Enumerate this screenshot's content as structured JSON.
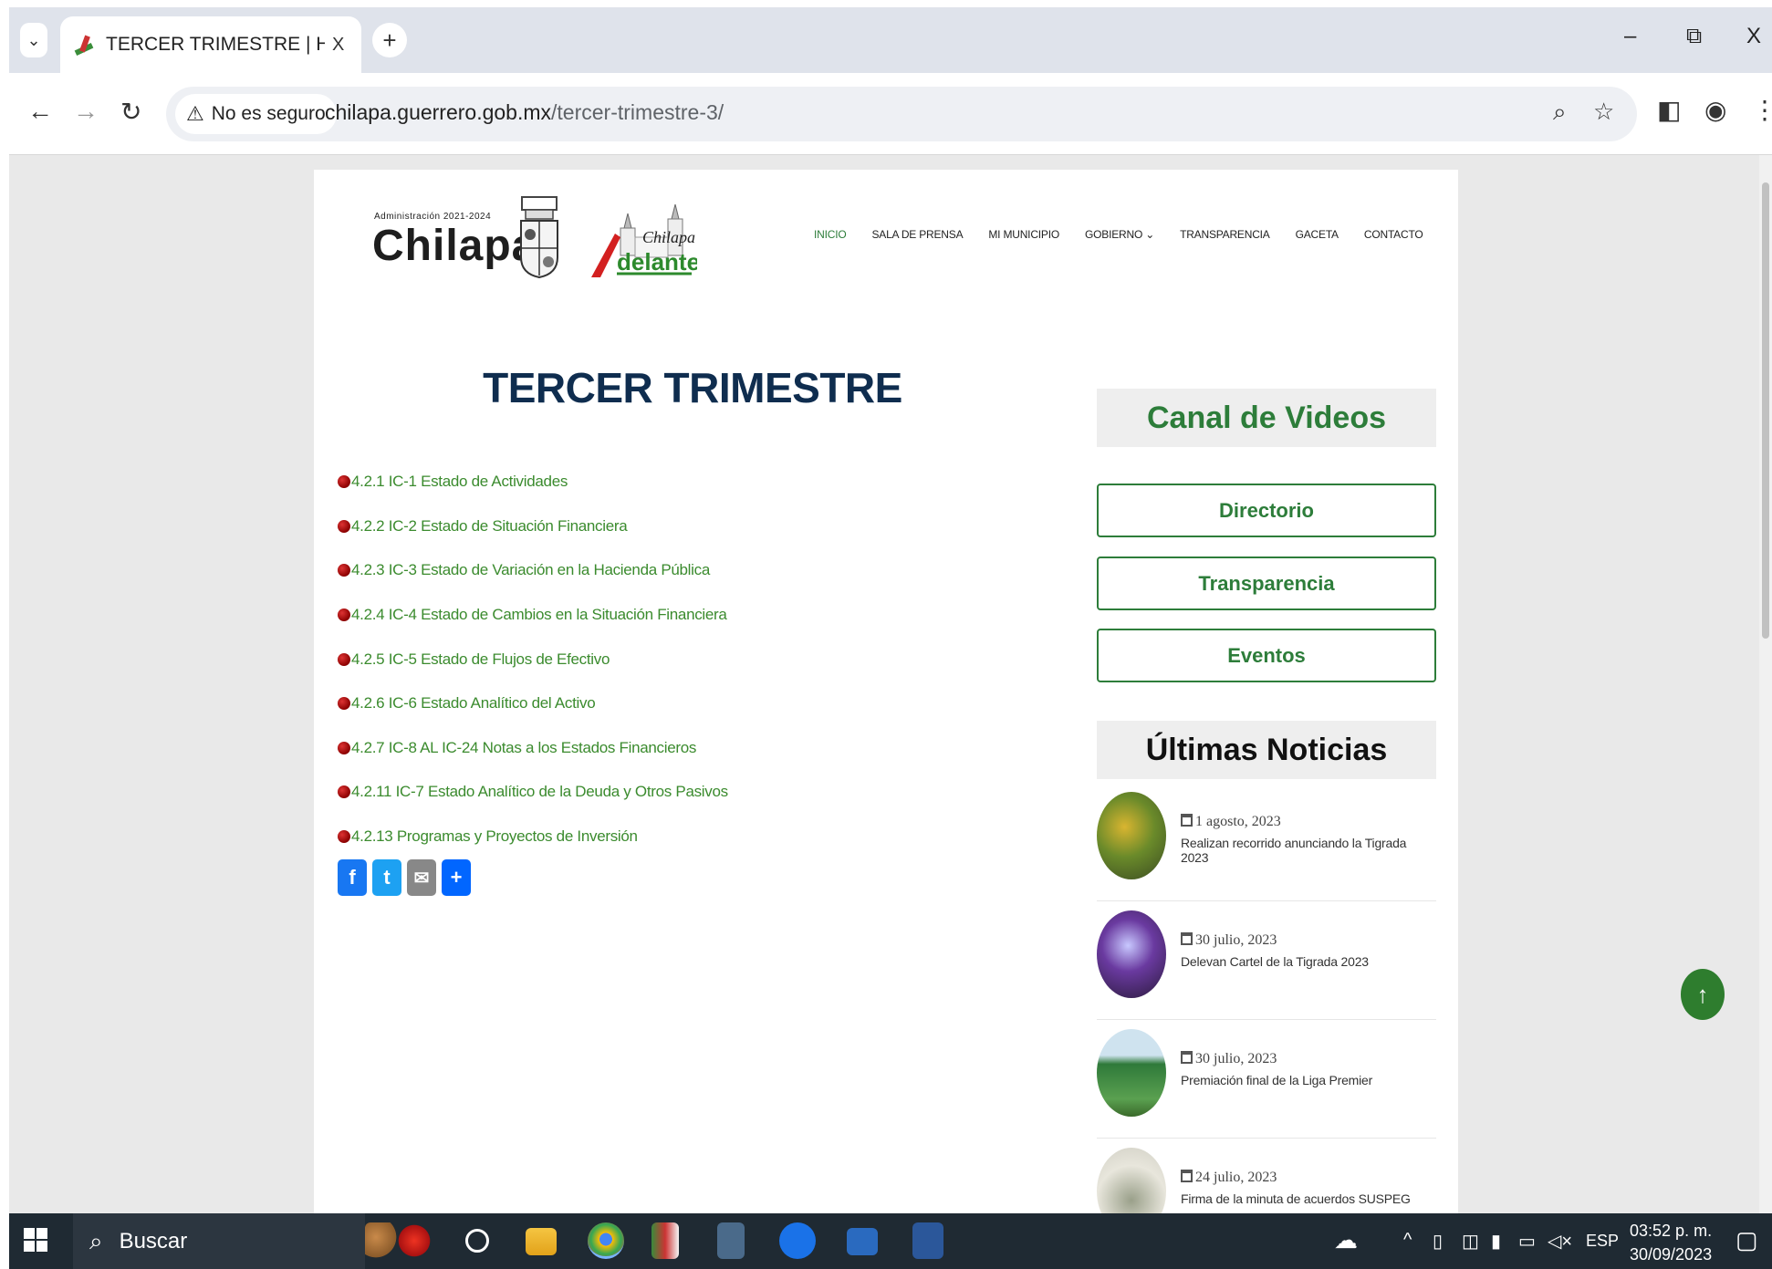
{
  "browser": {
    "tab_title": "TERCER TRIMESTRE | H. Ayunt",
    "tab_close": "X",
    "new_tab": "+",
    "security_label": "No es seguro",
    "url_host": "chilapa.guerrero.gob.mx",
    "url_path": "/tercer-trimestre-3/",
    "window_controls": {
      "minimize": "–",
      "restore": "⧉",
      "close": "X"
    }
  },
  "site": {
    "logo_admin": "Administración 2021-2024",
    "logo_name": "Chilapa",
    "nav": [
      "INICIO",
      "SALA DE PRENSA",
      "MI MUNICIPIO",
      "GOBIERNO ⌄",
      "TRANSPARENCIA",
      "GACETA",
      "CONTACTO"
    ],
    "nav_active": "INICIO"
  },
  "content": {
    "title": "TERCER TRIMESTRE",
    "documents": [
      "4.2.1 IC-1 Estado de Actividades",
      "4.2.2 IC-2 Estado de Situación Financiera",
      "4.2.3 IC-3 Estado de Variación en la Hacienda Pública",
      "4.2.4 IC-4 Estado de Cambios en la Situación Financiera",
      "4.2.5 IC-5 Estado de Flujos de Efectivo",
      "4.2.6 IC-6 Estado Analítico del Activo",
      "4.2.7 IC-8 AL IC-24 Notas a los Estados Financieros",
      "4.2.11 IC-7 Estado Analítico de la Deuda y Otros Pasivos",
      "4.2.13 Programas y Proyectos de Inversión"
    ],
    "share": [
      {
        "icon": "facebook-icon",
        "glyph": "f",
        "color": "#1877f2"
      },
      {
        "icon": "twitter-icon",
        "glyph": "t",
        "color": "#1da1f2"
      },
      {
        "icon": "email-icon",
        "glyph": "✉",
        "color": "#888888"
      },
      {
        "icon": "share-icon",
        "glyph": "+",
        "color": "#0166ff"
      }
    ]
  },
  "sidebar": {
    "video_channel": "Canal de Videos",
    "buttons": [
      "Directorio",
      "Transparencia",
      "Eventos"
    ],
    "news_heading": "Últimas Noticias",
    "news": [
      {
        "date": "1 agosto, 2023",
        "title": "Realizan recorrido anunciando la Tigrada 2023"
      },
      {
        "date": "30 julio, 2023",
        "title": "Delevan Cartel de la Tigrada 2023"
      },
      {
        "date": "30 julio, 2023",
        "title": "Premiación final de la Liga Premier"
      },
      {
        "date": "24 julio, 2023",
        "title": "Firma de la minuta de acuerdos SUSPEG"
      }
    ]
  },
  "taskbar": {
    "search_placeholder": "Buscar",
    "language": "ESP",
    "time": "03:52 p. m.",
    "date": "30/09/2023"
  },
  "colors": {
    "accent_green": "#2d7d3a",
    "title_navy": "#0f2d4f",
    "link_green": "#3b8b2e"
  }
}
